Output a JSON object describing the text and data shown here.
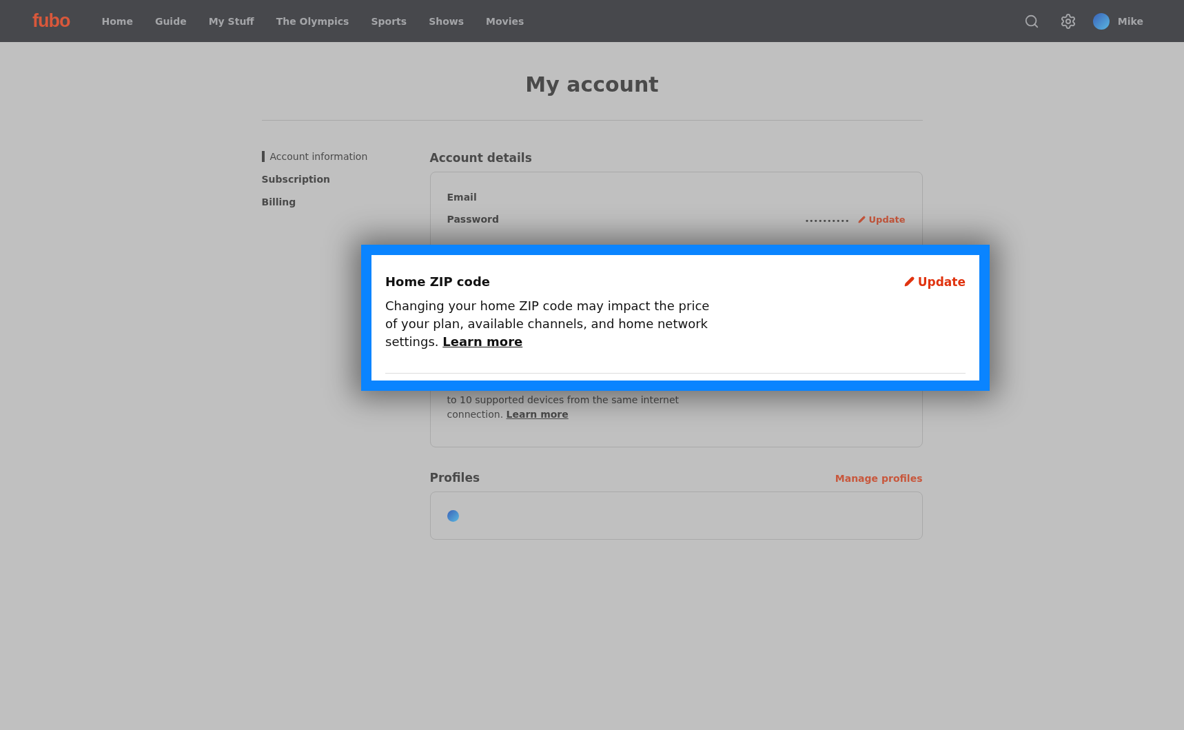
{
  "nav": {
    "logo": "fubo",
    "items": [
      {
        "label": "Home",
        "selected": false
      },
      {
        "label": "Guide",
        "selected": false
      },
      {
        "label": "My Stuff",
        "selected": false
      },
      {
        "label": "The Olympics",
        "selected": false
      },
      {
        "label": "Sports",
        "selected": false
      },
      {
        "label": "Shows",
        "selected": false
      },
      {
        "label": "Movies",
        "selected": false
      }
    ],
    "user": "Mike"
  },
  "title": "My account",
  "sidebar": {
    "items": [
      {
        "label": "Account information",
        "selected": true
      },
      {
        "label": "Subscription",
        "selected": false
      },
      {
        "label": "Billing",
        "selected": false
      }
    ]
  },
  "account_details": {
    "heading": "Account details",
    "rows": [
      {
        "label": "Email"
      },
      {
        "label": "Password",
        "value": "••••••••••",
        "action": "Update"
      }
    ],
    "home_network": {
      "text": "to 10 supported devices from the same internet connection.",
      "link": "Learn more"
    }
  },
  "profiles": {
    "heading": "Profiles",
    "action": "Manage profiles"
  },
  "highlight": {
    "title": "Home ZIP code",
    "action": "Update",
    "text": "Changing your home ZIP code may impact the price of your plan, available channels, and home network settings.",
    "link": "Learn more"
  }
}
